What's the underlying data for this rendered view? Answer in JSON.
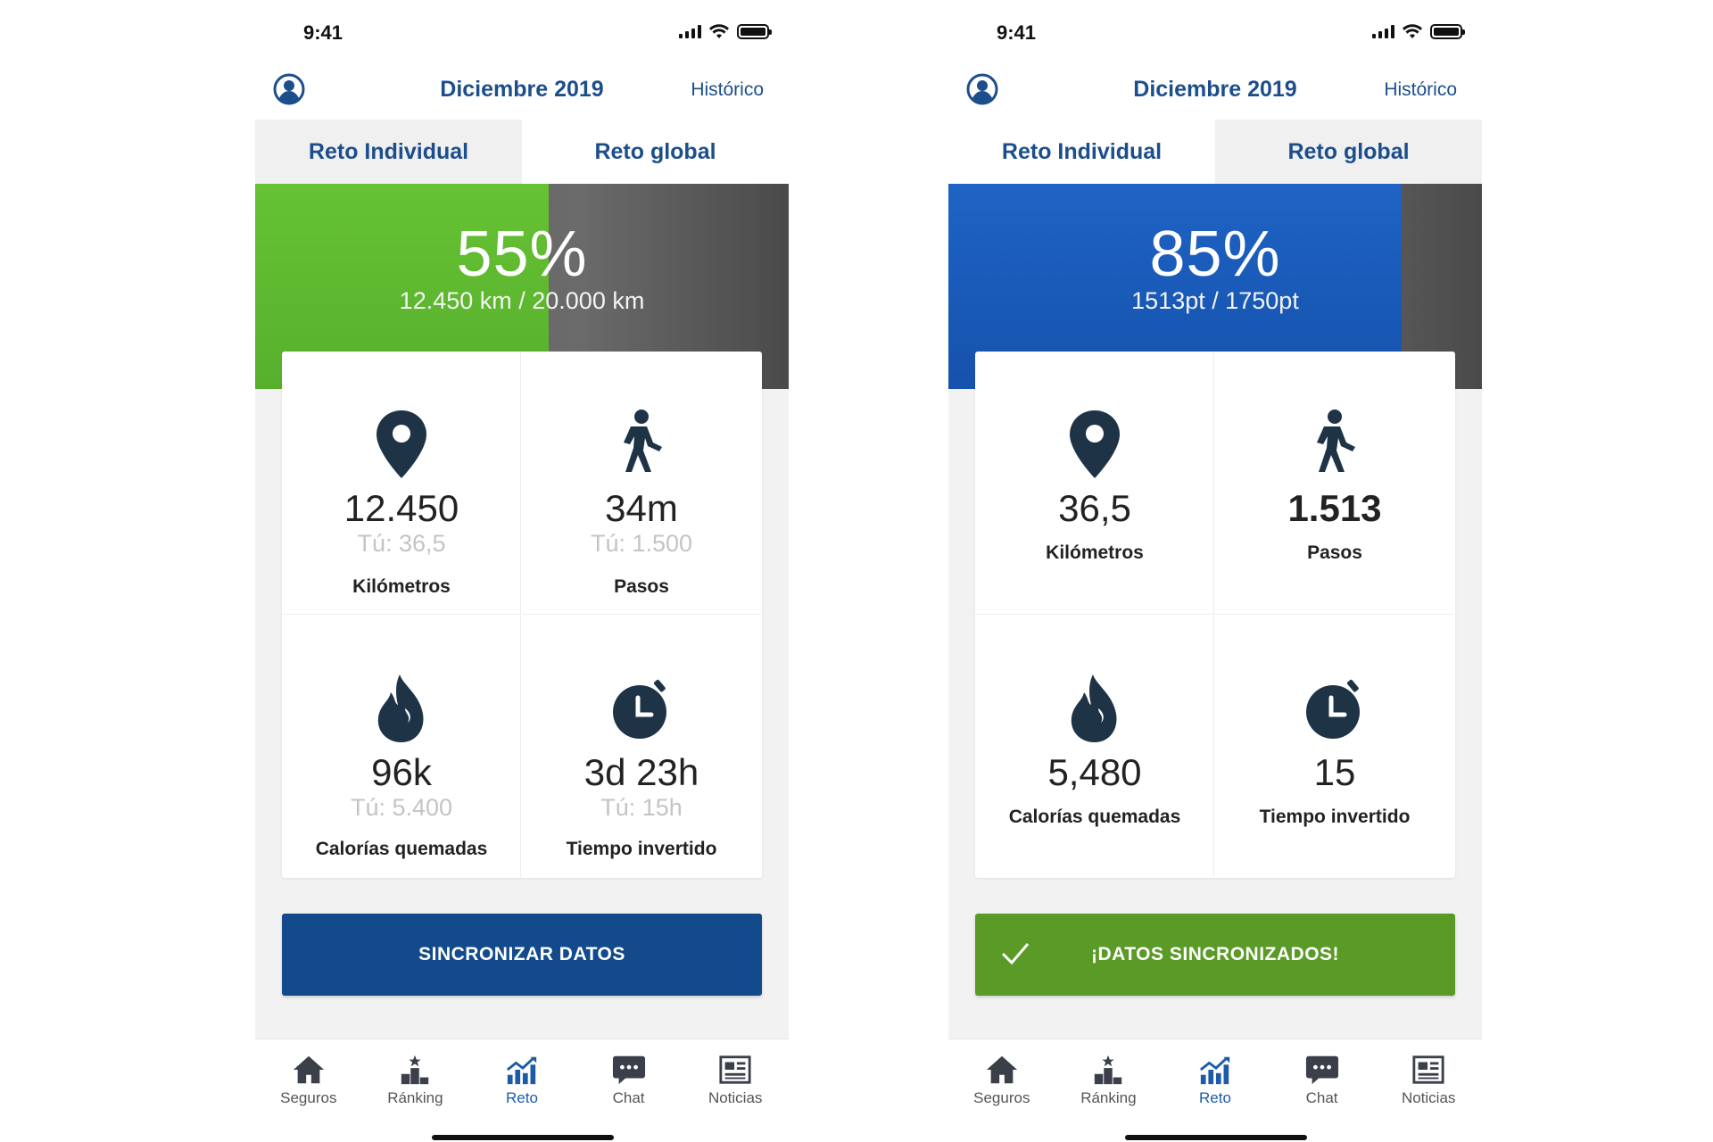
{
  "colors": {
    "brand_blue": "#1d4e8c",
    "progress_green": "#5fba30",
    "progress_blue": "#1a5cbd",
    "sync_blue": "#124a8c",
    "sync_green": "#5a9a26",
    "icon_dark": "#1f3347"
  },
  "left_screen": {
    "status_time": "9:41",
    "header": {
      "title": "Diciembre 2019",
      "history_link": "Histórico",
      "user_icon": "user-circle-icon"
    },
    "tabs": [
      {
        "label": "Reto Individual",
        "active": true
      },
      {
        "label": "Reto global",
        "active": false
      }
    ],
    "progress": {
      "percent_label": "55%",
      "detail": "12.450 km / 20.000 km",
      "fraction": 0.55
    },
    "stats": [
      {
        "icon": "location-pin-icon",
        "value": "12.450",
        "you": "Tú: 36,5",
        "label": "Kilómetros"
      },
      {
        "icon": "walking-person-icon",
        "value": "34m",
        "you": "Tú: 1.500",
        "label": "Pasos"
      },
      {
        "icon": "flame-icon",
        "value": "96k",
        "you": "Tú: 5.400",
        "label": "Calorías quemadas"
      },
      {
        "icon": "stopwatch-icon",
        "value": "3d 23h",
        "you": "Tú: 15h",
        "label": "Tiempo invertido"
      }
    ],
    "sync_button": {
      "label": "SINCRONIZAR DATOS"
    },
    "nav": [
      {
        "label": "Seguros",
        "icon": "home-icon",
        "active": false
      },
      {
        "label": "Ránking",
        "icon": "podium-icon",
        "active": false
      },
      {
        "label": "Reto",
        "icon": "chart-icon",
        "active": true
      },
      {
        "label": "Chat",
        "icon": "chat-bubble-icon",
        "active": false
      },
      {
        "label": "Noticias",
        "icon": "newspaper-icon",
        "active": false
      }
    ]
  },
  "right_screen": {
    "status_time": "9:41",
    "header": {
      "title": "Diciembre 2019",
      "history_link": "Histórico",
      "user_icon": "user-circle-icon"
    },
    "tabs": [
      {
        "label": "Reto Individual",
        "active": false
      },
      {
        "label": "Reto global",
        "active": true
      }
    ],
    "progress": {
      "percent_label": "85%",
      "detail": "1513pt / 1750pt",
      "fraction": 0.85
    },
    "stats": [
      {
        "icon": "location-pin-icon",
        "value": "36,5",
        "label": "Kilómetros"
      },
      {
        "icon": "walking-person-icon",
        "value": "1.513",
        "label": "Pasos"
      },
      {
        "icon": "flame-icon",
        "value": "5,480",
        "label": "Calorías quemadas"
      },
      {
        "icon": "stopwatch-icon",
        "value": "15",
        "label": "Tiempo invertido"
      }
    ],
    "sync_button": {
      "label": "¡DATOS SINCRONIZADOS!",
      "icon": "checkmark-icon"
    },
    "nav": [
      {
        "label": "Seguros",
        "icon": "home-icon",
        "active": false
      },
      {
        "label": "Ránking",
        "icon": "podium-icon",
        "active": false
      },
      {
        "label": "Reto",
        "icon": "chart-icon",
        "active": true
      },
      {
        "label": "Chat",
        "icon": "chat-bubble-icon",
        "active": false
      },
      {
        "label": "Noticias",
        "icon": "newspaper-icon",
        "active": false
      }
    ]
  }
}
